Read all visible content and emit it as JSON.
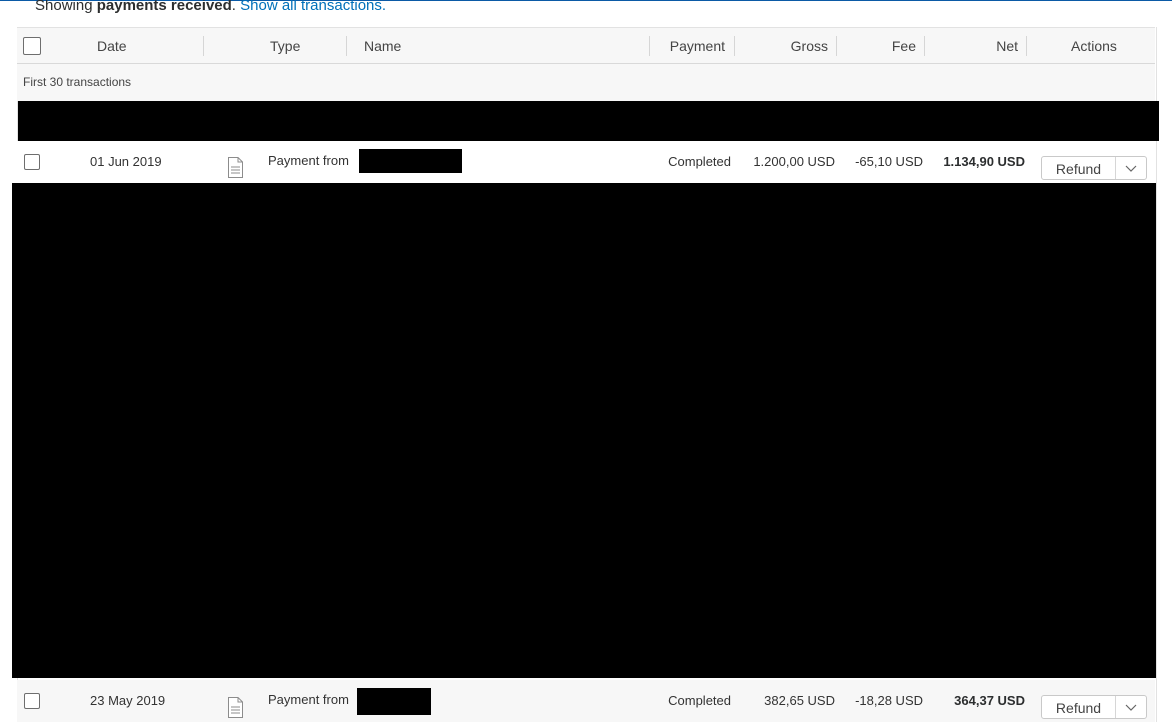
{
  "summary": {
    "prefix": "Showing ",
    "filter": "payments received",
    "dot": ".",
    "link": "Show all transactions."
  },
  "columns": {
    "date": "Date",
    "type": "Type",
    "name": "Name",
    "payment": "Payment",
    "gross": "Gross",
    "fee": "Fee",
    "net": "Net",
    "actions": "Actions"
  },
  "group_label": "First 30 transactions",
  "rows": [
    {
      "date": "01 Jun 2019",
      "type": "Payment from",
      "icon": "document-icon",
      "payment_status": "Completed",
      "gross": "1.200,00 USD",
      "fee": "-65,10 USD",
      "net": "1.134,90 USD",
      "action": "Refund",
      "action_menu_icon": "chevron-down-icon"
    },
    {
      "date": "23 May 2019",
      "type": "Payment from",
      "icon": "document-icon",
      "payment_status": "Completed",
      "gross": "382,65 USD",
      "fee": "-18,28 USD",
      "net": "364,37 USD",
      "action": "Refund",
      "action_menu_icon": "chevron-down-icon"
    }
  ],
  "colors": {
    "link": "#0070ba",
    "header_bg": "#f7f7f7",
    "border": "#e2e2e2",
    "redaction": "#000000"
  }
}
